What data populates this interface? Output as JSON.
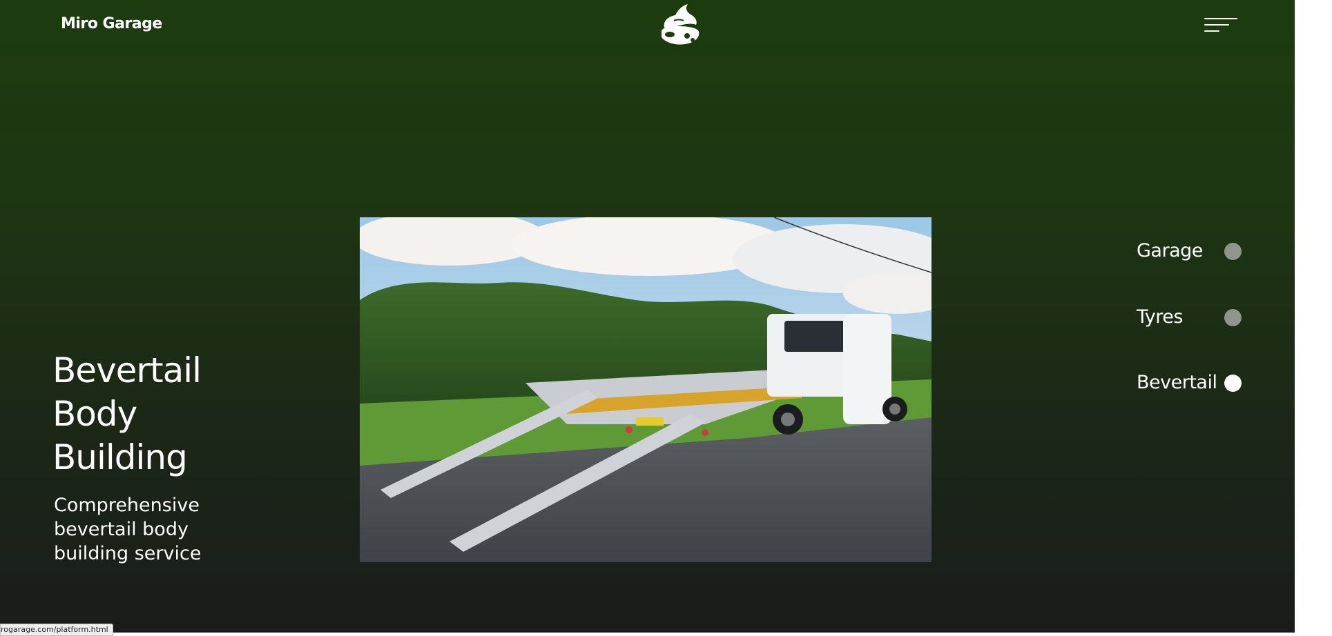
{
  "header": {
    "brand": "Miro Garage",
    "logo_icon": "garage-mascot-logo-icon",
    "menu_icon": "hamburger-menu-icon"
  },
  "hero": {
    "title_lines": [
      "Bevertail",
      "Body",
      "Building"
    ],
    "subtitle_lines": [
      "Comprehensive",
      "bevertail body",
      "building service"
    ],
    "image": "recovery-truck-with-loading-ramps-photo"
  },
  "side_nav": {
    "items": [
      {
        "label": "Garage",
        "active": false
      },
      {
        "label": "Tyres",
        "active": false
      },
      {
        "label": "Bevertail",
        "active": true
      }
    ]
  },
  "status_bar": {
    "url": "rogarage.com/platform.html"
  },
  "colors": {
    "background_top": "#1c3c10",
    "background_bottom": "#1a1c1b",
    "text": "#ffffff",
    "dot_inactive": "#8f978d",
    "dot_active": "#ffffff"
  }
}
